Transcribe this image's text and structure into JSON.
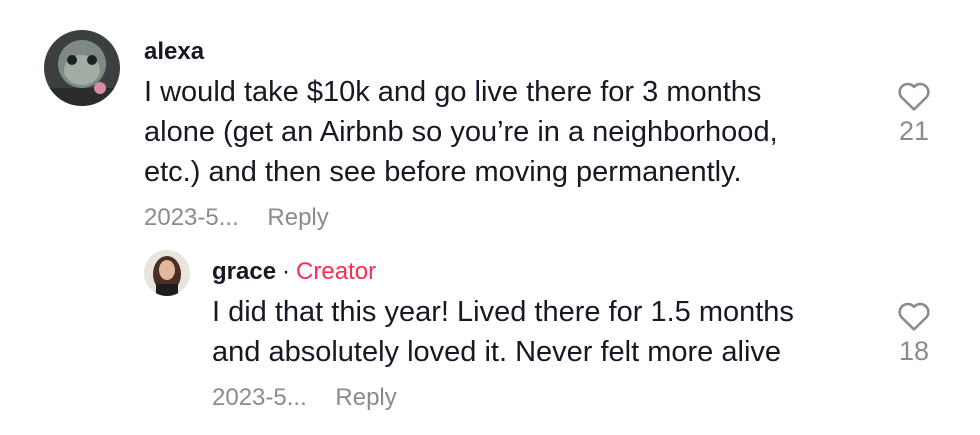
{
  "comments": [
    {
      "username": "alexa",
      "text_lines": [
        "I would take $10k and go live there for 3 months",
        "alone (get an Airbnb so you’re in a neighborhood,",
        "etc.) and then see before moving permanently."
      ],
      "date": "2023-5...",
      "reply_label": "Reply",
      "likes": "21",
      "like_icon": "heart-outline-icon"
    }
  ],
  "replies": [
    {
      "username": "grace",
      "separator": "·",
      "badge": "Creator",
      "text_lines": [
        "I did that this year! Lived there for 1.5 months",
        "and absolutely loved it. Never felt more alive"
      ],
      "date": "2023-5...",
      "reply_label": "Reply",
      "likes": "18",
      "like_icon": "heart-outline-icon"
    }
  ],
  "colors": {
    "creator_badge": "#fe2c55",
    "muted": "#8a8b91",
    "text": "#161823"
  }
}
